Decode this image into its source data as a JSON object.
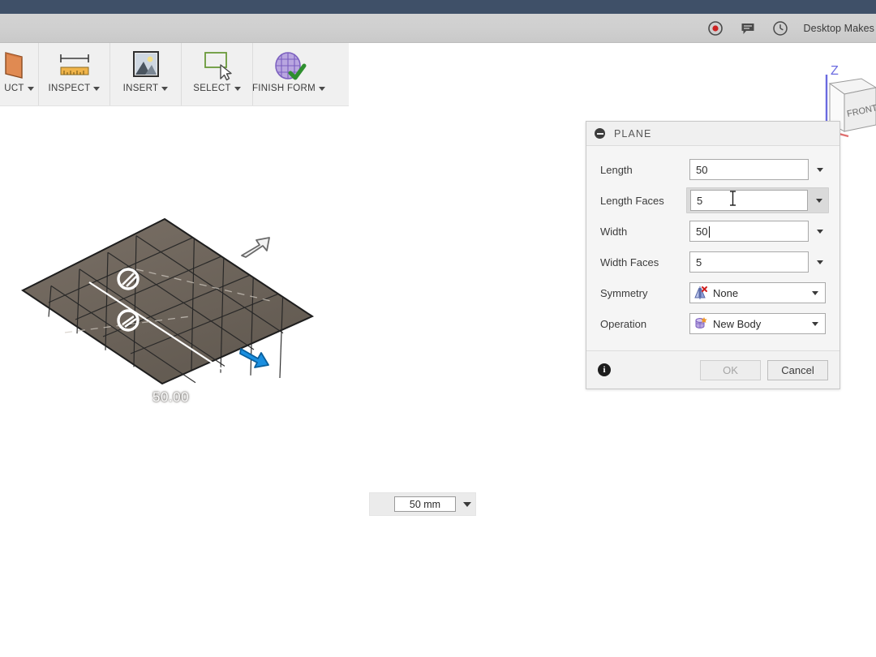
{
  "header": {
    "account_name": "Desktop Makes",
    "icons": [
      {
        "name": "record-icon",
        "glyph": "record"
      },
      {
        "name": "comments-icon",
        "glyph": "comment"
      },
      {
        "name": "history-clock-icon",
        "glyph": "clock"
      }
    ]
  },
  "ribbon": {
    "items": [
      {
        "label": "UCT",
        "full_label": "CONSTRUCT",
        "icon": "construct-plane-icon",
        "has_caret": true
      },
      {
        "label": "INSPECT",
        "icon": "inspect-ruler-icon",
        "has_caret": true
      },
      {
        "label": "INSERT",
        "icon": "insert-image-icon",
        "has_caret": true
      },
      {
        "label": "SELECT",
        "icon": "select-cursor-icon",
        "has_caret": true
      },
      {
        "label": "FINISH FORM",
        "icon": "finish-form-icon",
        "has_caret": true
      }
    ]
  },
  "viewcube": {
    "axis_label": "Z",
    "face_label": "FRONT"
  },
  "model": {
    "dimension_label": "50.00",
    "grid_faces_u": 5,
    "grid_faces_v": 5
  },
  "dimension_editor": {
    "value": "50 mm"
  },
  "dialog": {
    "title": "PLANE",
    "rows": [
      {
        "label": "Length",
        "value": "50",
        "type": "combo",
        "state": "normal",
        "icon": null
      },
      {
        "label": "Length Faces",
        "value": "5",
        "type": "combo",
        "state": "hovered",
        "icon": null
      },
      {
        "label": "Width",
        "value": "50",
        "type": "combo",
        "state": "editing",
        "icon": null
      },
      {
        "label": "Width Faces",
        "value": "5",
        "type": "combo",
        "state": "normal",
        "icon": null
      },
      {
        "label": "Symmetry",
        "value": "None",
        "type": "select",
        "state": "normal",
        "icon": "symmetry-none-icon"
      },
      {
        "label": "Operation",
        "value": "New Body",
        "type": "select",
        "state": "normal",
        "icon": "new-body-icon"
      }
    ],
    "footer": {
      "info_glyph": "i",
      "ok_label": "OK",
      "cancel_label": "Cancel",
      "ok_disabled": true
    }
  },
  "colors": {
    "titlebar": "#3f5068",
    "dialog_bg": "#f5f5f5",
    "model_face": "#6e665d",
    "manipulator_blue": "#1a8fe0",
    "accent_red": "#cc2222"
  }
}
